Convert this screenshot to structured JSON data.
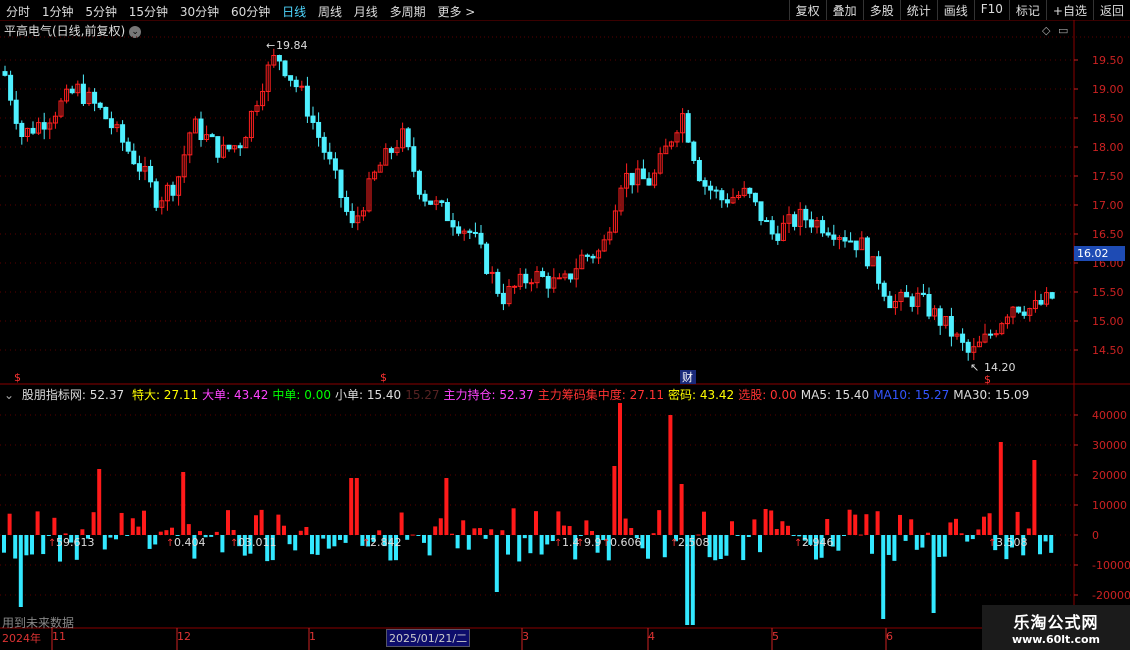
{
  "toolbar": {
    "periods": [
      "分时",
      "1分钟",
      "5分钟",
      "15分钟",
      "30分钟",
      "60分钟",
      "日线",
      "周线",
      "月线",
      "多周期",
      "更多 >"
    ],
    "active_period": "日线",
    "actions": [
      "复权",
      "叠加",
      "多股",
      "统计",
      "画线",
      "F10",
      "标记",
      "+自选",
      "返回"
    ]
  },
  "stock": {
    "title": "平高电气(日线,前复权)",
    "current_price_badge": "16.02",
    "high_label": "19.84",
    "low_label": "14.20"
  },
  "price_axis": {
    "ticks": [
      "19.50",
      "19.00",
      "18.50",
      "18.00",
      "17.50",
      "17.00",
      "16.50",
      "16.00",
      "15.50",
      "15.00",
      "14.50"
    ]
  },
  "indicator": {
    "name": "股朋指标网",
    "main_value": ": 52.37",
    "fields": [
      {
        "label": "特大:",
        "value": "27.11",
        "color": "#ffff00"
      },
      {
        "label": "大单:",
        "value": "43.42",
        "color": "#ff44ff"
      },
      {
        "label": "中单:",
        "value": "0.00",
        "color": "#00ff00"
      },
      {
        "label": "小单:",
        "value": "15.40",
        "color": "#dddddd"
      },
      {
        "label": "",
        "value": "15.27",
        "color": "#552222"
      },
      {
        "label": "主力持仓:",
        "value": "52.37",
        "color": "#ff44ff"
      },
      {
        "label": "主力筹码集中度:",
        "value": "27.11",
        "color": "#ff3333"
      },
      {
        "label": "密码:",
        "value": "43.42",
        "color": "#ffff00"
      },
      {
        "label": "选股:",
        "value": "0.00",
        "color": "#ff3333"
      },
      {
        "label": "MA5:",
        "value": "15.40",
        "color": "#dddddd"
      },
      {
        "label": "MA10:",
        "value": "15.27",
        "color": "#3355ff"
      },
      {
        "label": "MA30:",
        "value": "15.09",
        "color": "#dddddd"
      }
    ],
    "axis_ticks": [
      "40000",
      "30000",
      "20000",
      "10000",
      "0",
      "-10000",
      "-20000"
    ],
    "bar_labels": [
      "59.613",
      "0.404",
      "03.011",
      "2.842",
      "1.4",
      "9.9",
      "0.606",
      "2.508",
      "2.946",
      "3.508"
    ]
  },
  "markers": {
    "s": "$",
    "cai": "财"
  },
  "hint": "用到未来数据",
  "date_bar": {
    "year": "2024年",
    "months": [
      "11",
      "12",
      "1",
      "3",
      "4",
      "5",
      "6"
    ],
    "highlight": "2025/01/21/二"
  },
  "watermark": {
    "title": "乐淘公式网",
    "url": "www.60lt.com"
  },
  "colors": {
    "up": "#ff2020",
    "down": "#4ff0ff",
    "grid": "#5a0000",
    "axis": "#cc2222"
  }
}
